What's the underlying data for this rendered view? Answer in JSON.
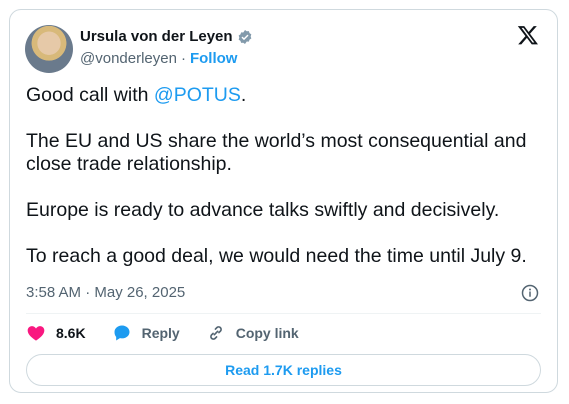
{
  "author": {
    "name": "Ursula von der Leyen",
    "handle": "@vonderleyen",
    "separator": "·",
    "follow_label": "Follow",
    "verified_color": "#829aab"
  },
  "tweet": {
    "greeting_prefix": "Good call with ",
    "mention": "@POTUS",
    "greeting_suffix": ".",
    "paragraph_2": "The EU and US share the world’s most consequential and close trade relationship.",
    "paragraph_3": "Europe is ready to advance talks swiftly and decisively.",
    "paragraph_4": "To reach a good deal, we would need the time until July 9."
  },
  "meta": {
    "timestamp": "3:58 AM · May 26, 2025"
  },
  "actions": {
    "like_count": "8.6K",
    "reply_label": "Reply",
    "copy_link_label": "Copy link"
  },
  "footer": {
    "read_replies_label": "Read 1.7K replies"
  },
  "colors": {
    "accent": "#1d9bf0",
    "like": "#f91880",
    "muted": "#536471",
    "text": "#0f1419"
  }
}
